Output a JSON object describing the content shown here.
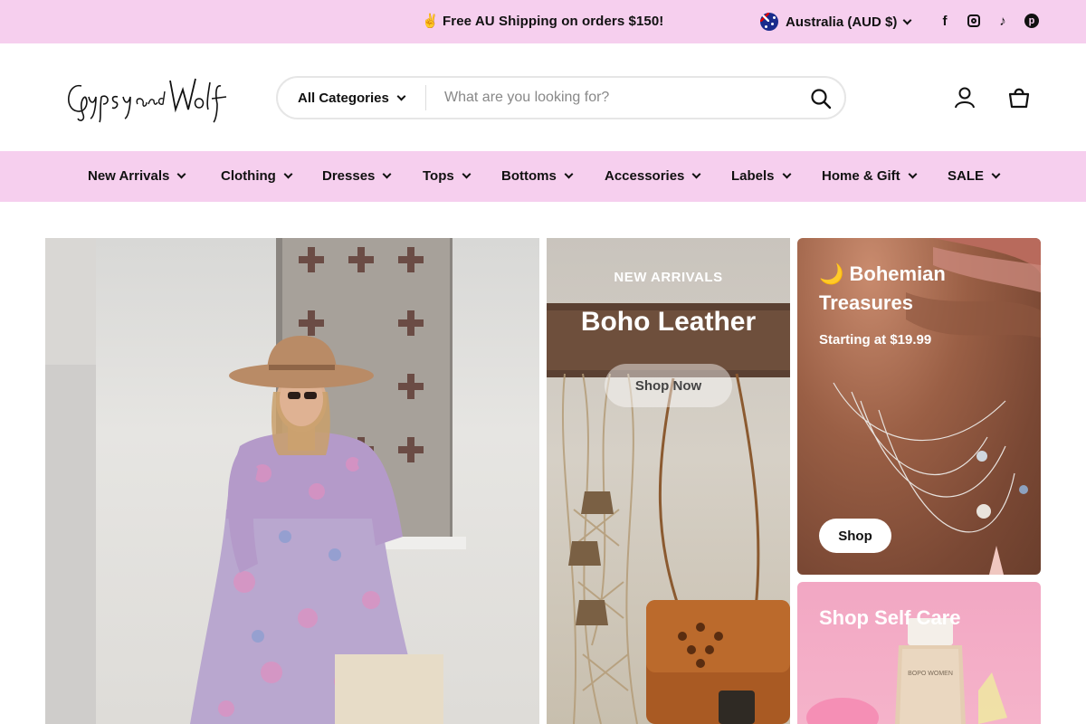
{
  "announcement": {
    "text": "✌️ Free AU Shipping on orders $150!"
  },
  "region": {
    "label": "Australia (AUD $)"
  },
  "social": {
    "facebook": "f",
    "tiktok": "♪",
    "pinterest": "p"
  },
  "logo": {
    "text": "Gypsy and Wolf"
  },
  "search": {
    "category_label": "All Categories",
    "placeholder": "What are you looking for?"
  },
  "nav": {
    "items": [
      {
        "label": "New Arrivals"
      },
      {
        "label": "Clothing"
      },
      {
        "label": "Dresses"
      },
      {
        "label": "Tops"
      },
      {
        "label": "Bottoms"
      },
      {
        "label": "Accessories"
      },
      {
        "label": "Labels"
      },
      {
        "label": "Home & Gift"
      },
      {
        "label": "SALE"
      }
    ]
  },
  "promos": {
    "leather": {
      "eyebrow": "NEW ARRIVALS",
      "title": "Boho Leather",
      "button": "Shop Now"
    },
    "bohemian": {
      "title_line1": "🌙 Bohemian",
      "title_line2": "Treasures",
      "subtitle": "Starting at $19.99",
      "button": "Shop"
    },
    "selfcare": {
      "title": "Shop Self Care",
      "product_label": "BOPO WOMEN"
    }
  },
  "colors": {
    "accent_pink": "#f6cfee",
    "text": "#111111"
  }
}
